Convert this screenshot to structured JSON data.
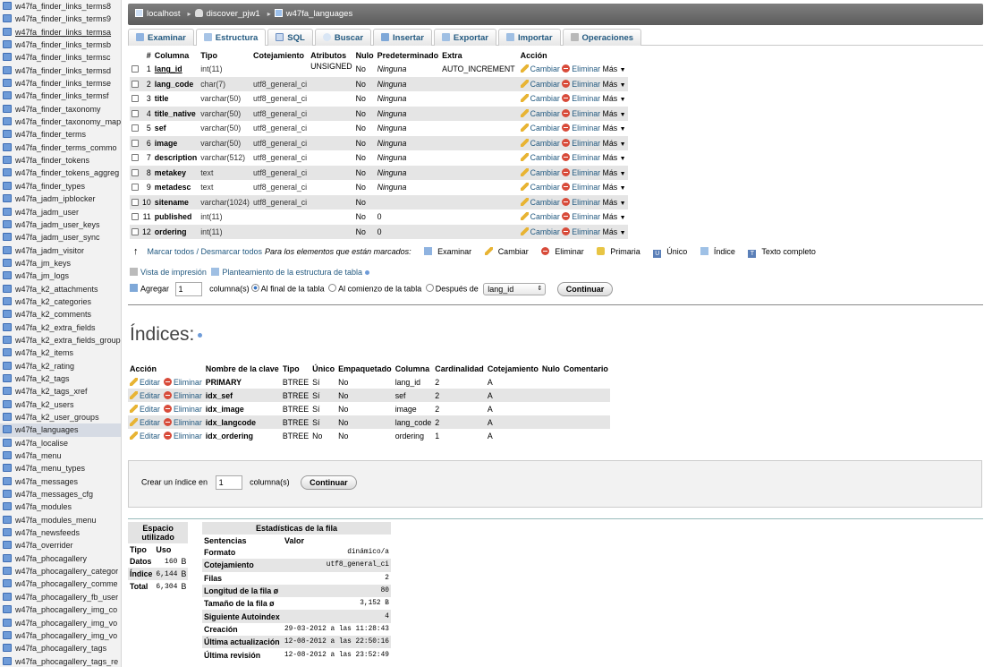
{
  "sidebar": {
    "items": [
      "w47fa_finder_links_terms8",
      "w47fa_finder_links_terms9",
      "w47fa_finder_links_termsa",
      "w47fa_finder_links_termsb",
      "w47fa_finder_links_termsc",
      "w47fa_finder_links_termsd",
      "w47fa_finder_links_termse",
      "w47fa_finder_links_termsf",
      "w47fa_finder_taxonomy",
      "w47fa_finder_taxonomy_map",
      "w47fa_finder_terms",
      "w47fa_finder_terms_commo",
      "w47fa_finder_tokens",
      "w47fa_finder_tokens_aggreg",
      "w47fa_finder_types",
      "w47fa_jadm_ipblocker",
      "w47fa_jadm_user",
      "w47fa_jadm_user_keys",
      "w47fa_jadm_user_sync",
      "w47fa_jadm_visitor",
      "w47fa_jm_keys",
      "w47fa_jm_logs",
      "w47fa_k2_attachments",
      "w47fa_k2_categories",
      "w47fa_k2_comments",
      "w47fa_k2_extra_fields",
      "w47fa_k2_extra_fields_group",
      "w47fa_k2_items",
      "w47fa_k2_rating",
      "w47fa_k2_tags",
      "w47fa_k2_tags_xref",
      "w47fa_k2_users",
      "w47fa_k2_user_groups",
      "w47fa_languages",
      "w47fa_localise",
      "w47fa_menu",
      "w47fa_menu_types",
      "w47fa_messages",
      "w47fa_messages_cfg",
      "w47fa_modules",
      "w47fa_modules_menu",
      "w47fa_newsfeeds",
      "w47fa_overrider",
      "w47fa_phocagallery",
      "w47fa_phocagallery_categor",
      "w47fa_phocagallery_comme",
      "w47fa_phocagallery_fb_user",
      "w47fa_phocagallery_img_co",
      "w47fa_phocagallery_img_vo",
      "w47fa_phocagallery_img_vo",
      "w47fa_phocagallery_tags",
      "w47fa_phocagallery_tags_re"
    ]
  },
  "breadcrumb": {
    "server": "localhost",
    "database": "discover_pjw1",
    "table": "w47fa_languages"
  },
  "tabs": [
    "Examinar",
    "Estructura",
    "SQL",
    "Buscar",
    "Insertar",
    "Exportar",
    "Importar",
    "Operaciones"
  ],
  "structure": {
    "headers": [
      "#",
      "Columna",
      "Tipo",
      "Cotejamiento",
      "Atributos",
      "Nulo",
      "Predeterminado",
      "Extra",
      "Acción"
    ],
    "rows": [
      {
        "n": "1",
        "name": "lang_id",
        "type": "int(11)",
        "coll": "",
        "attr": "UNSIGNED",
        "null": "No",
        "def": "Ninguna",
        "extra": "AUTO_INCREMENT"
      },
      {
        "n": "2",
        "name": "lang_code",
        "type": "char(7)",
        "coll": "utf8_general_ci",
        "attr": "",
        "null": "No",
        "def": "Ninguna",
        "extra": ""
      },
      {
        "n": "3",
        "name": "title",
        "type": "varchar(50)",
        "coll": "utf8_general_ci",
        "attr": "",
        "null": "No",
        "def": "Ninguna",
        "extra": ""
      },
      {
        "n": "4",
        "name": "title_native",
        "type": "varchar(50)",
        "coll": "utf8_general_ci",
        "attr": "",
        "null": "No",
        "def": "Ninguna",
        "extra": ""
      },
      {
        "n": "5",
        "name": "sef",
        "type": "varchar(50)",
        "coll": "utf8_general_ci",
        "attr": "",
        "null": "No",
        "def": "Ninguna",
        "extra": ""
      },
      {
        "n": "6",
        "name": "image",
        "type": "varchar(50)",
        "coll": "utf8_general_ci",
        "attr": "",
        "null": "No",
        "def": "Ninguna",
        "extra": ""
      },
      {
        "n": "7",
        "name": "description",
        "type": "varchar(512)",
        "coll": "utf8_general_ci",
        "attr": "",
        "null": "No",
        "def": "Ninguna",
        "extra": ""
      },
      {
        "n": "8",
        "name": "metakey",
        "type": "text",
        "coll": "utf8_general_ci",
        "attr": "",
        "null": "No",
        "def": "Ninguna",
        "extra": ""
      },
      {
        "n": "9",
        "name": "metadesc",
        "type": "text",
        "coll": "utf8_general_ci",
        "attr": "",
        "null": "No",
        "def": "Ninguna",
        "extra": ""
      },
      {
        "n": "10",
        "name": "sitename",
        "type": "varchar(1024)",
        "coll": "utf8_general_ci",
        "attr": "",
        "null": "No",
        "def": "",
        "extra": ""
      },
      {
        "n": "11",
        "name": "published",
        "type": "int(11)",
        "coll": "",
        "attr": "",
        "null": "No",
        "def": "0",
        "extra": ""
      },
      {
        "n": "12",
        "name": "ordering",
        "type": "int(11)",
        "coll": "",
        "attr": "",
        "null": "No",
        "def": "0",
        "extra": ""
      }
    ],
    "actions": {
      "change": "Cambiar",
      "drop": "Eliminar",
      "more": "Más"
    }
  },
  "bulk": {
    "check_all": "Marcar todos / Desmarcar todos",
    "with_selected": "Para los elementos que están marcados:",
    "buttons": [
      "Examinar",
      "Cambiar",
      "Eliminar",
      "Primaria",
      "Único",
      "Índice",
      "Texto completo"
    ]
  },
  "print_view": "Vista de impresión",
  "propose": "Planteamiento de la estructura de tabla",
  "add": {
    "label": "Agregar",
    "count": "1",
    "columns": "columna(s)",
    "at_end": "Al final de la tabla",
    "at_start": "Al comienzo de la tabla",
    "after": "Después de",
    "after_col": "lang_id",
    "go": "Continuar"
  },
  "indexes": {
    "title": "Índices:",
    "headers": [
      "Acción",
      "Nombre de la clave",
      "Tipo",
      "Único",
      "Empaquetado",
      "Columna",
      "Cardinalidad",
      "Cotejamiento",
      "Nulo",
      "Comentario"
    ],
    "edit": "Editar",
    "drop": "Eliminar",
    "rows": [
      {
        "key": "PRIMARY",
        "type": "BTREE",
        "unique": "Sí",
        "packed": "No",
        "col": "lang_id",
        "card": "2",
        "coll": "A"
      },
      {
        "key": "idx_sef",
        "type": "BTREE",
        "unique": "Sí",
        "packed": "No",
        "col": "sef",
        "card": "2",
        "coll": "A"
      },
      {
        "key": "idx_image",
        "type": "BTREE",
        "unique": "Sí",
        "packed": "No",
        "col": "image",
        "card": "2",
        "coll": "A"
      },
      {
        "key": "idx_langcode",
        "type": "BTREE",
        "unique": "Sí",
        "packed": "No",
        "col": "lang_code",
        "card": "2",
        "coll": "A"
      },
      {
        "key": "idx_ordering",
        "type": "BTREE",
        "unique": "No",
        "packed": "No",
        "col": "ordering",
        "card": "1",
        "coll": "A"
      }
    ]
  },
  "create_index": {
    "label": "Crear un índice en",
    "count": "1",
    "columns": "columna(s)",
    "go": "Continuar"
  },
  "space": {
    "title": "Espacio utilizado",
    "headers": [
      "Tipo",
      "Uso"
    ],
    "rows": [
      {
        "type": "Datos",
        "val": "160",
        "unit": "B"
      },
      {
        "type": "Índice",
        "val": "6,144",
        "unit": "B"
      },
      {
        "type": "Total",
        "val": "6,304",
        "unit": "B"
      }
    ]
  },
  "rowstats": {
    "title": "Estadísticas de la fila",
    "headers": [
      "Sentencias",
      "Valor"
    ],
    "rows": [
      {
        "k": "Formato",
        "v": "dinámico/a"
      },
      {
        "k": "Cotejamiento",
        "v": "utf8_general_ci"
      },
      {
        "k": "Filas",
        "v": "2"
      },
      {
        "k": "Longitud de la fila ø",
        "v": "80"
      },
      {
        "k": "Tamaño de la fila ø",
        "v": "3,152 B"
      },
      {
        "k": "Siguiente Autoindex",
        "v": "4"
      },
      {
        "k": "Creación",
        "v": "29-03-2012 a las 11:28:43"
      },
      {
        "k": "Última actualización",
        "v": "12-08-2012 a las 22:50:16"
      },
      {
        "k": "Última revisión",
        "v": "12-08-2012 a las 23:52:49"
      }
    ]
  }
}
